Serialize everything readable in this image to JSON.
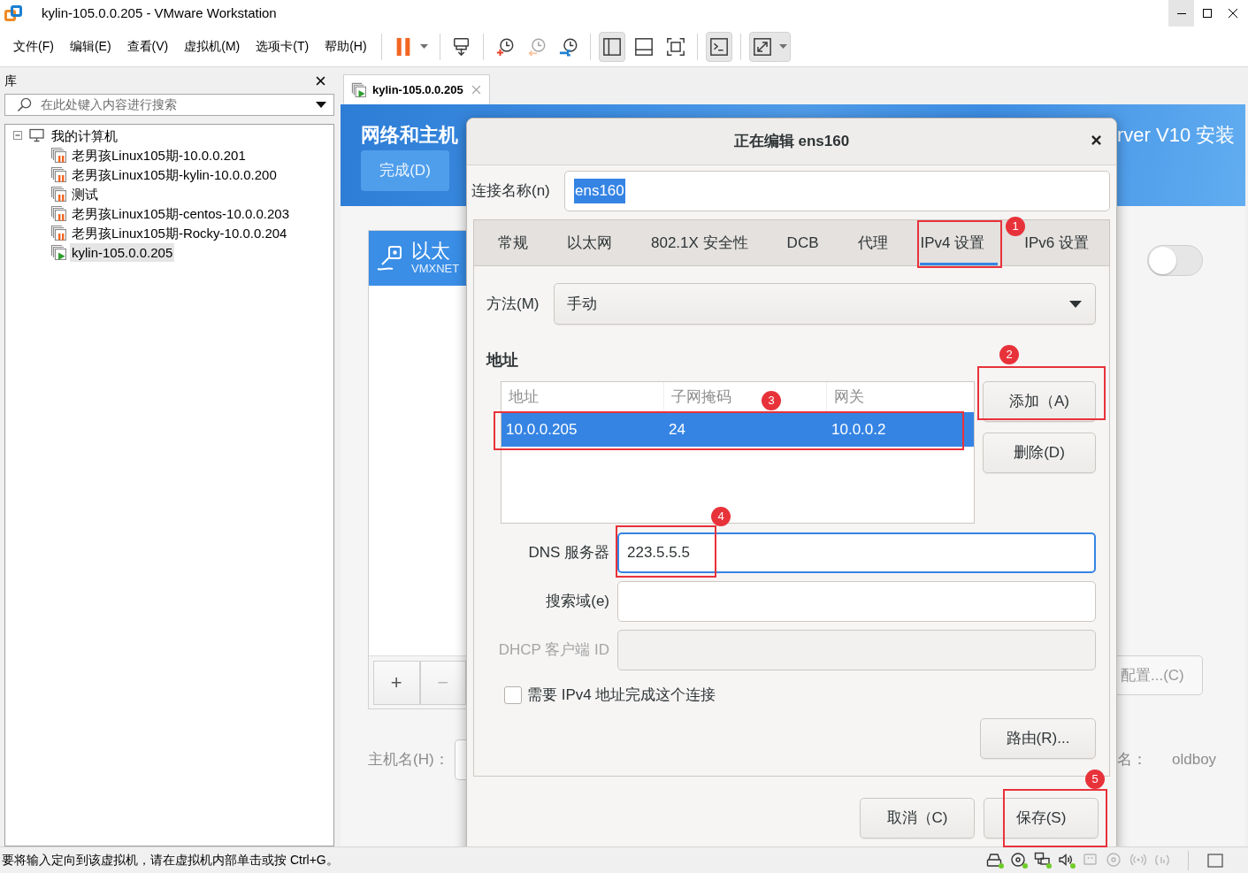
{
  "window": {
    "title": "kylin-105.0.0.205 - VMware Workstation",
    "controls": [
      {
        "kind": "minimize",
        "hovered": true
      },
      {
        "kind": "maximize",
        "hovered": false
      },
      {
        "kind": "close",
        "hovered": false
      }
    ]
  },
  "menu": [
    "文件(F)",
    "编辑(E)",
    "查看(V)",
    "虚拟机(M)",
    "选项卡(T)",
    "帮助(H)"
  ],
  "toolbar": [
    [
      {
        "kind": "pause",
        "pressed": false,
        "disabled": false,
        "dropdown": true
      }
    ],
    [
      {
        "kind": "sendkeys",
        "pressed": false,
        "disabled": false,
        "dropdown": false
      }
    ],
    [
      {
        "kind": "snapshot",
        "pressed": false,
        "disabled": false,
        "dropdown": false
      },
      {
        "kind": "revert",
        "pressed": false,
        "disabled": true,
        "dropdown": false
      },
      {
        "kind": "manager",
        "pressed": false,
        "disabled": false,
        "dropdown": false
      }
    ],
    [
      {
        "kind": "library",
        "pressed": true,
        "disabled": false,
        "dropdown": false
      },
      {
        "kind": "thumbnails",
        "pressed": false,
        "disabled": false,
        "dropdown": false
      },
      {
        "kind": "fullscreen",
        "pressed": false,
        "disabled": false,
        "dropdown": false
      }
    ],
    [
      {
        "kind": "console",
        "pressed": true,
        "disabled": false,
        "dropdown": false
      }
    ],
    [
      {
        "kind": "stretch",
        "pressed": true,
        "disabled": false,
        "dropdown": true
      }
    ]
  ],
  "library": {
    "title": "库",
    "search": {
      "placeholder": "在此处键入内容进行搜索"
    },
    "tree": {
      "label": "我的计算机",
      "expanded": true,
      "children": [
        {
          "label": "老男孩Linux105期-10.0.0.201",
          "kind": "suspended",
          "selected": false
        },
        {
          "label": "老男孩Linux105期-kylin-10.0.0.200",
          "kind": "suspended",
          "selected": false
        },
        {
          "label": "测试",
          "kind": "suspended",
          "selected": false
        },
        {
          "label": "老男孩Linux105期-centos-10.0.0.203",
          "kind": "suspended",
          "selected": false
        },
        {
          "label": "老男孩Linux105期-Rocky-10.0.0.204",
          "kind": "suspended",
          "selected": false
        },
        {
          "label": "kylin-105.0.0.205",
          "kind": "running",
          "selected": true
        }
      ]
    }
  },
  "tabs": [
    {
      "label": "kylin-105.0.0.205",
      "selected": true
    }
  ],
  "guest": {
    "heading": "网络和主机",
    "done_button": "完成(D)",
    "installer_title": "rver V10 安装",
    "device": {
      "name": "以太",
      "detail": "VMXNET"
    },
    "device_switch": {
      "on": false
    },
    "device_buttons": [
      {
        "label": "+",
        "disabled": false
      },
      {
        "label": "−",
        "disabled": true
      }
    ],
    "configure_button": "配置...(C)",
    "hostname_label": "主机名(H)：",
    "current_hostname_label": "名：",
    "current_hostname": "oldboy"
  },
  "dialog": {
    "title": "正在编辑 ens160",
    "connection_name": {
      "label": "连接名称(n)",
      "value": "ens160",
      "value_selected": true
    },
    "tabs": [
      {
        "label": "常规",
        "selected": false
      },
      {
        "label": "以太网",
        "selected": false
      },
      {
        "label": "802.1X 安全性",
        "selected": false
      },
      {
        "label": "DCB",
        "selected": false
      },
      {
        "label": "代理",
        "selected": false
      },
      {
        "label": "IPv4 设置",
        "selected": true
      },
      {
        "label": "IPv6 设置",
        "selected": false
      }
    ],
    "method": {
      "label": "方法(M)",
      "value": "手动"
    },
    "addresses": {
      "title": "地址",
      "columns": [
        "地址",
        "子网掩码",
        "网关"
      ],
      "rows": [
        {
          "cells": [
            "10.0.0.205",
            "24",
            "10.0.0.2"
          ],
          "selected": true
        }
      ]
    },
    "address_buttons": [
      "添加（A)",
      "删除(D)"
    ],
    "fields": [
      {
        "label": "DNS 服务器",
        "value": "223.5.5.5",
        "focused": true,
        "disabled": false
      },
      {
        "label": "搜索域(e)",
        "focused": false,
        "disabled": false
      },
      {
        "label": "DHCP 客户端 ID",
        "focused": false,
        "disabled": true
      }
    ],
    "require_ipv4": {
      "label": "需要 IPv4 地址完成这个连接",
      "checked": false
    },
    "routes_button": "路由(R)...",
    "buttons": [
      "取消（C)",
      "保存(S)"
    ]
  },
  "annotations": [
    {
      "label": "1"
    },
    {
      "label": "2"
    },
    {
      "label": "3"
    },
    {
      "label": "4"
    },
    {
      "label": "5"
    }
  ],
  "status_bar": {
    "text": "要将输入定向到该虚拟机，请在虚拟机内部单击或按 Ctrl+G。",
    "devices": [
      {
        "kind": "disk",
        "active": true
      },
      {
        "kind": "cd",
        "active": true
      },
      {
        "kind": "network",
        "active": true
      },
      {
        "kind": "sound",
        "active": true
      },
      {
        "kind": "usb",
        "active": false
      },
      {
        "kind": "cd",
        "active": false
      },
      {
        "kind": "wireless",
        "active": false
      },
      {
        "kind": "signal",
        "active": false
      }
    ]
  }
}
